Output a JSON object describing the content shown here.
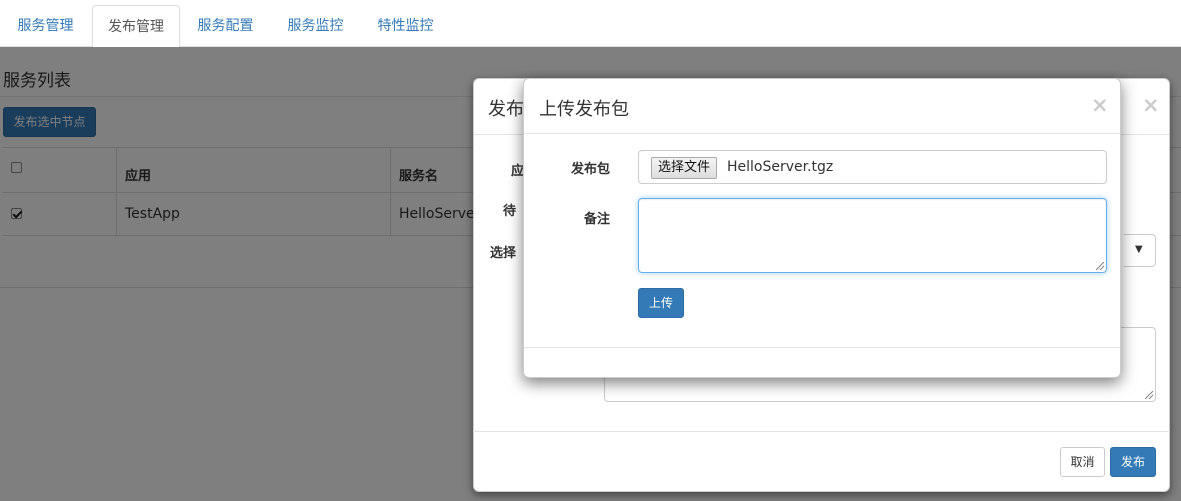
{
  "nav": {
    "tabs": [
      {
        "label": "服务管理",
        "active": false
      },
      {
        "label": "发布管理",
        "active": true
      },
      {
        "label": "服务配置",
        "active": false
      },
      {
        "label": "服务监控",
        "active": false
      },
      {
        "label": "特性监控",
        "active": false
      }
    ]
  },
  "page": {
    "title": "服务列表",
    "publish_selected_label": "发布选中节点",
    "table": {
      "headers": [
        "",
        "应用",
        "服务名"
      ],
      "rows": [
        {
          "checked": true,
          "app": "TestApp",
          "server": "HelloServer"
        }
      ]
    }
  },
  "publish_modal": {
    "title_partial": "发布",
    "close": "×",
    "field_labels_partial": [
      "应",
      "待",
      "选择"
    ],
    "cancel_label": "取消",
    "publish_label": "发布"
  },
  "upload_modal": {
    "title": "上传发布包",
    "close": "×",
    "package_label": "发布包",
    "file_button_label": "选择文件",
    "file_name": "HelloServer.tgz",
    "note_label": "备注",
    "note_value": "",
    "upload_label": "上传"
  },
  "colors": {
    "link": "#337ab7",
    "primary": "#337ab7",
    "focus_border": "#66afe9"
  }
}
